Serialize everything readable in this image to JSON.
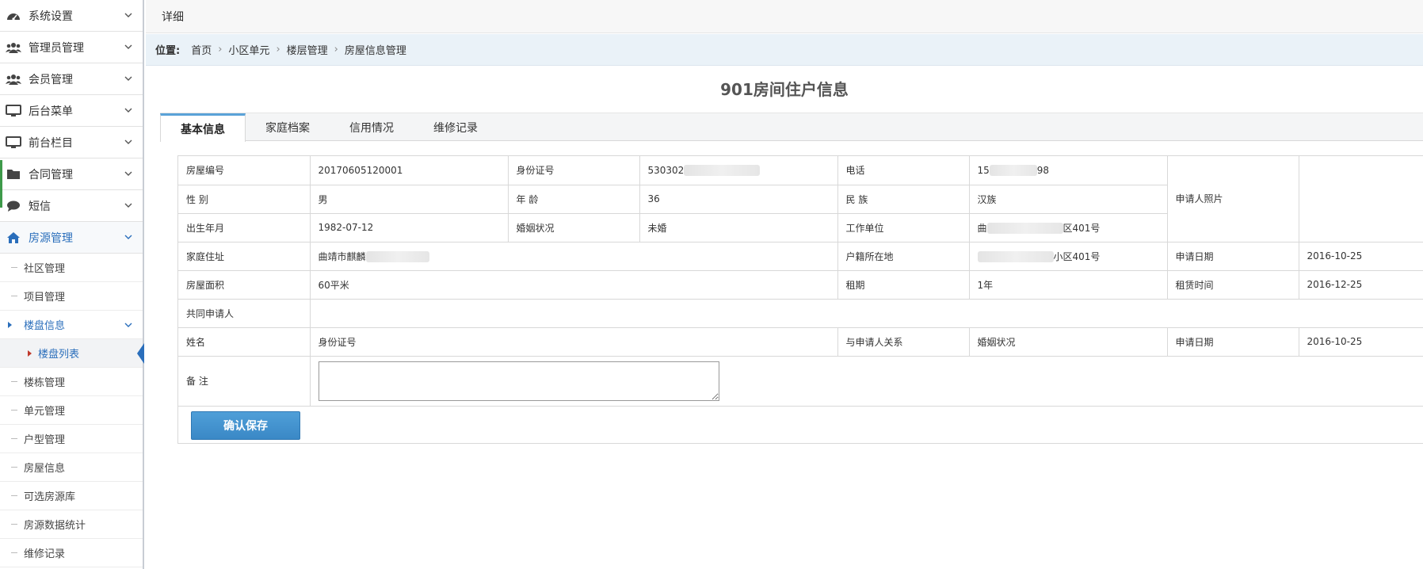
{
  "sidebar": {
    "menu": [
      {
        "label": "系统设置",
        "icon": "dashboard-icon"
      },
      {
        "label": "管理员管理",
        "icon": "users-icon"
      },
      {
        "label": "会员管理",
        "icon": "users-icon"
      },
      {
        "label": "后台菜单",
        "icon": "monitor-icon"
      },
      {
        "label": "前台栏目",
        "icon": "monitor-icon"
      },
      {
        "label": "合同管理",
        "icon": "folder-icon"
      },
      {
        "label": "短信",
        "icon": "chat-icon"
      },
      {
        "label": "房源管理",
        "icon": "home-icon"
      }
    ],
    "sub": [
      {
        "label": "社区管理"
      },
      {
        "label": "项目管理"
      },
      {
        "label": "楼盘信息"
      },
      {
        "label": "楼盘列表"
      },
      {
        "label": "楼栋管理"
      },
      {
        "label": "单元管理"
      },
      {
        "label": "户型管理"
      },
      {
        "label": "房屋信息"
      },
      {
        "label": "可选房源库"
      },
      {
        "label": "房源数据统计"
      },
      {
        "label": "维修记录"
      }
    ]
  },
  "topbar": {
    "title": "详细"
  },
  "breadcrumb": {
    "prefix": "位置:",
    "items": [
      "首页",
      "小区单元",
      "楼层管理",
      "房屋信息管理"
    ],
    "sep": "›"
  },
  "page": {
    "title": "901房间住户信息"
  },
  "tabs": [
    "基本信息",
    "家庭档案",
    "信用情况",
    "维修记录"
  ],
  "form": {
    "house_no_label": "房屋编号",
    "house_no": "20170605120001",
    "id_label": "身份证号",
    "id_value": "530302",
    "phone_label": "电话",
    "phone_prefix": "15",
    "phone_suffix": "98",
    "photo_label": "申请人照片",
    "gender_label": "性 别",
    "gender": "男",
    "age_label": "年 龄",
    "age": "36",
    "nation_label": "民 族",
    "nation": "汉族",
    "birth_label": "出生年月",
    "birth": "1982-07-12",
    "marital_label": "婚姻状况",
    "marital": "未婚",
    "work_label": "工作单位",
    "work_prefix": "曲",
    "work_suffix": "区401号",
    "address_label": "家庭住址",
    "address": "曲靖市麒麟",
    "hukou_label": "户籍所在地",
    "hukou_suffix": "小区401号",
    "apply_date_label": "申请日期",
    "apply_date": "2016-10-25",
    "area_label": "房屋面积",
    "area": "60平米",
    "lease_label": "租期",
    "lease": "1年",
    "rent_time_label": "租赁时间",
    "rent_time": "2016-12-25",
    "co_applicant_label": "共同申请人",
    "name_col": "姓名",
    "id_col": "身份证号",
    "relation_col": "与申请人关系",
    "marital_col": "婚姻状况",
    "apply_date_col": "申请日期",
    "apply_date_col_value": "2016-10-25",
    "remark_label": "备 注",
    "remark_value": ""
  },
  "buttons": {
    "save": "确认保存"
  }
}
